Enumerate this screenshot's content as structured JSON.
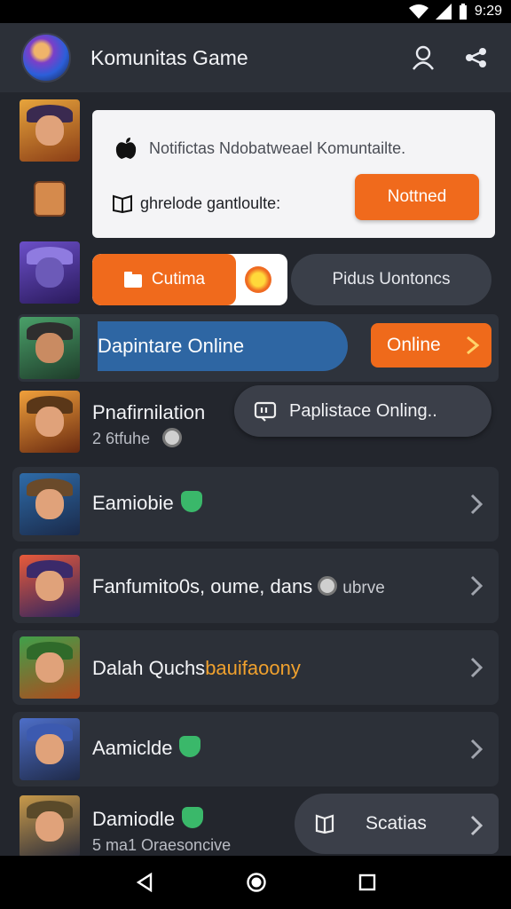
{
  "status_bar": {
    "time": "9:29"
  },
  "header": {
    "title": "Komunitas Game",
    "profile_icon": "user-icon",
    "share_icon": "share-icon"
  },
  "notification": {
    "message": "Notifictas Ndobatweael Komuntailte.",
    "detail": "ghrelode gantloulte:",
    "button_label": "Nottned"
  },
  "pills": {
    "orange_label": "Cutima",
    "dark_label": "Pidus Uontoncs"
  },
  "online_row": {
    "title": "Dapintare Online",
    "button_label": "Online"
  },
  "rows": [
    {
      "title": "Pnafirnilation",
      "subtitle": "2 6tfuhe"
    },
    {
      "title": "Eamiobie"
    },
    {
      "title_part1": "Fanfumito0s, oume, dans",
      "title_part2": "ubrve"
    },
    {
      "title_part1": "Dalah Quchs",
      "title_part2": "bauifaoony"
    },
    {
      "title": "Aamiclde"
    },
    {
      "title": "Damiodle",
      "subtitle": "5 ma1 Oraesoncive"
    }
  ],
  "floating": {
    "playlist_label": "Paplistace Onling..",
    "scatias_label": "Scatias"
  },
  "colors": {
    "accent": "#f06a1c",
    "blue": "#2e66a3",
    "bg": "#23262d"
  }
}
